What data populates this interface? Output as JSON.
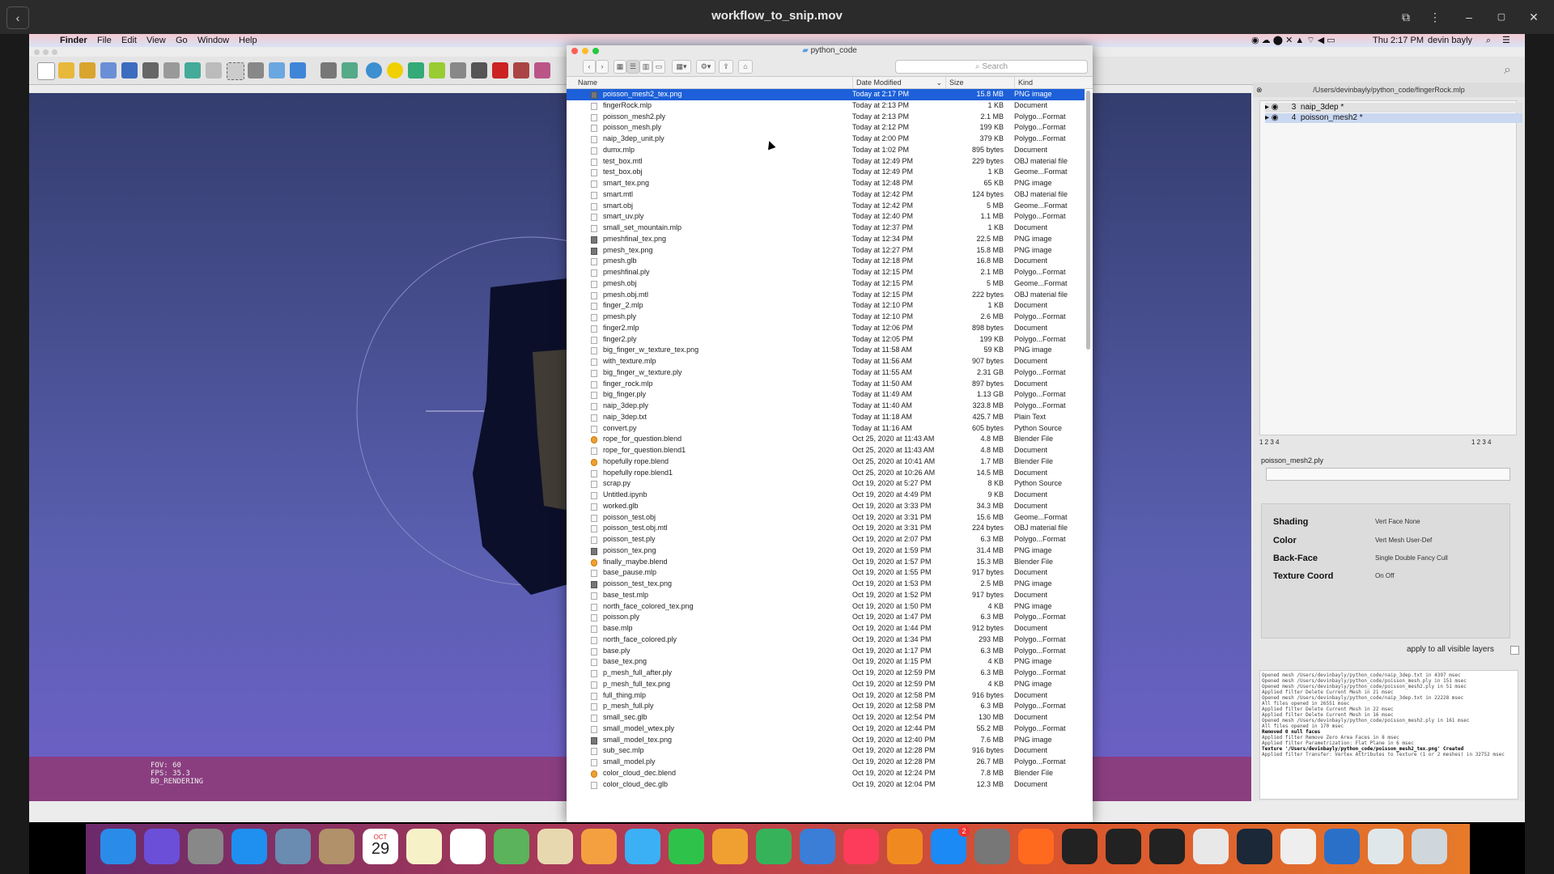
{
  "player": {
    "title": "workflow_to_snip.mov",
    "back_icon": "‹",
    "min_icon": "–",
    "max_icon": "▢",
    "close_icon": "✕"
  },
  "menubar": {
    "app_name": "Finder",
    "menus": [
      "File",
      "Edit",
      "View",
      "Go",
      "Window",
      "Help"
    ],
    "clock": "Thu 2:17 PM",
    "user": "devin bayly"
  },
  "meshlab": {
    "fov_lines": [
      "FOV: 60",
      "FPS:   35.3",
      "BO_RENDERING"
    ],
    "right_panel": {
      "path": "/Users/devinbayly/python_code/fingerRock.mlp",
      "layers": [
        {
          "index": "3",
          "name": "naip_3dep *"
        },
        {
          "index": "4",
          "name": "poisson_mesh2 *"
        }
      ],
      "pager_left": "1  2  3  4",
      "pager_right": "1  2  3  4",
      "mesh_name": "poisson_mesh2.ply",
      "settings": [
        {
          "label": "Shading",
          "options": "Vert  Face  None"
        },
        {
          "label": "Color",
          "options": "Vert  Mesh  User-Def"
        },
        {
          "label": "Back-Face",
          "options": "Single  Double  Fancy  Cull"
        },
        {
          "label": "Texture Coord",
          "options": "On  Off"
        }
      ],
      "apply_label": "apply to all visible layers",
      "log_lines": [
        "Opened mesh /Users/devinbayly/python_code/naip_3dep.txt in 4397 msec",
        "Opened mesh /Users/devinbayly/python_code/poisson_mesh.ply in 151 msec",
        "Opened mesh /Users/devinbayly/python_code/poisson_mesh2.ply in 51 msec",
        "Applied filter Delete Current Mesh in 21 msec",
        "Opened mesh /Users/devinbayly/python_code/naip_3dep.txt in 22228 msec",
        "All files opened in 26551 msec",
        "Applied filter Delete Current Mesh in 22 msec",
        "Applied filter Delete Current Mesh in 16 msec",
        "Opened mesh /Users/devinbayly/python_code/poisson_mesh2.ply in 161 msec",
        "All files opened in 170 msec",
        "Removed 0 null faces",
        "Applied filter Remove Zero Area Faces in 8 msec",
        "Applied filter Parametrization: Flat Plane in 6 msec",
        "Texture '/Users/devinbayly/python_code/poisson_mesh2_tex.png' Created",
        "Applied filter Transfer: Vertex Attributes to Texture (1 or 2 meshes) in 32752 msec"
      ]
    }
  },
  "finder": {
    "folder_title": "python_code",
    "search_placeholder": "Search",
    "columns": {
      "name": "Name",
      "date": "Date Modified",
      "size": "Size",
      "kind": "Kind"
    },
    "files": [
      {
        "name": "poisson_mesh2_tex.png",
        "date": "Today at 2:17 PM",
        "size": "15.8 MB",
        "kind": "PNG image",
        "icon": "img",
        "selected": true
      },
      {
        "name": "fingerRock.mlp",
        "date": "Today at 2:13 PM",
        "size": "1 KB",
        "kind": "Document",
        "icon": "doc"
      },
      {
        "name": "poisson_mesh2.ply",
        "date": "Today at 2:13 PM",
        "size": "2.1 MB",
        "kind": "Polygo...Format",
        "icon": "doc"
      },
      {
        "name": "poisson_mesh.ply",
        "date": "Today at 2:12 PM",
        "size": "199 KB",
        "kind": "Polygo...Format",
        "icon": "doc"
      },
      {
        "name": "naip_3dep_unit.ply",
        "date": "Today at 2:00 PM",
        "size": "379 KB",
        "kind": "Polygo...Format",
        "icon": "doc"
      },
      {
        "name": "dumx.mlp",
        "date": "Today at 1:02 PM",
        "size": "895 bytes",
        "kind": "Document",
        "icon": "doc"
      },
      {
        "name": "test_box.mtl",
        "date": "Today at 12:49 PM",
        "size": "229 bytes",
        "kind": "OBJ material file",
        "icon": "doc"
      },
      {
        "name": "test_box.obj",
        "date": "Today at 12:49 PM",
        "size": "1 KB",
        "kind": "Geome...Format",
        "icon": "doc"
      },
      {
        "name": "smart_tex.png",
        "date": "Today at 12:48 PM",
        "size": "65 KB",
        "kind": "PNG image",
        "icon": "doc"
      },
      {
        "name": "smart.mtl",
        "date": "Today at 12:42 PM",
        "size": "124 bytes",
        "kind": "OBJ material file",
        "icon": "doc"
      },
      {
        "name": "smart.obj",
        "date": "Today at 12:42 PM",
        "size": "5 MB",
        "kind": "Geome...Format",
        "icon": "doc"
      },
      {
        "name": "smart_uv.ply",
        "date": "Today at 12:40 PM",
        "size": "1.1 MB",
        "kind": "Polygo...Format",
        "icon": "doc"
      },
      {
        "name": "small_set_mountain.mlp",
        "date": "Today at 12:37 PM",
        "size": "1 KB",
        "kind": "Document",
        "icon": "doc"
      },
      {
        "name": "pmeshfinal_tex.png",
        "date": "Today at 12:34 PM",
        "size": "22.5 MB",
        "kind": "PNG image",
        "icon": "img"
      },
      {
        "name": "pmesh_tex.png",
        "date": "Today at 12:27 PM",
        "size": "15.8 MB",
        "kind": "PNG image",
        "icon": "img"
      },
      {
        "name": "pmesh.glb",
        "date": "Today at 12:18 PM",
        "size": "16.8 MB",
        "kind": "Document",
        "icon": "doc"
      },
      {
        "name": "pmeshfinal.ply",
        "date": "Today at 12:15 PM",
        "size": "2.1 MB",
        "kind": "Polygo...Format",
        "icon": "doc"
      },
      {
        "name": "pmesh.obj",
        "date": "Today at 12:15 PM",
        "size": "5 MB",
        "kind": "Geome...Format",
        "icon": "doc"
      },
      {
        "name": "pmesh.obj.mtl",
        "date": "Today at 12:15 PM",
        "size": "222 bytes",
        "kind": "OBJ material file",
        "icon": "doc"
      },
      {
        "name": "finger_2.mlp",
        "date": "Today at 12:10 PM",
        "size": "1 KB",
        "kind": "Document",
        "icon": "doc"
      },
      {
        "name": "pmesh.ply",
        "date": "Today at 12:10 PM",
        "size": "2.6 MB",
        "kind": "Polygo...Format",
        "icon": "doc"
      },
      {
        "name": "finger2.mlp",
        "date": "Today at 12:06 PM",
        "size": "898 bytes",
        "kind": "Document",
        "icon": "doc"
      },
      {
        "name": "finger2.ply",
        "date": "Today at 12:05 PM",
        "size": "199 KB",
        "kind": "Polygo...Format",
        "icon": "doc"
      },
      {
        "name": "big_finger_w_texture_tex.png",
        "date": "Today at 11:58 AM",
        "size": "59 KB",
        "kind": "PNG image",
        "icon": "doc"
      },
      {
        "name": "with_texture.mlp",
        "date": "Today at 11:56 AM",
        "size": "907 bytes",
        "kind": "Document",
        "icon": "doc"
      },
      {
        "name": "big_finger_w_texture.ply",
        "date": "Today at 11:55 AM",
        "size": "2.31 GB",
        "kind": "Polygo...Format",
        "icon": "doc"
      },
      {
        "name": "finger_rock.mlp",
        "date": "Today at 11:50 AM",
        "size": "897 bytes",
        "kind": "Document",
        "icon": "doc"
      },
      {
        "name": "big_finger.ply",
        "date": "Today at 11:49 AM",
        "size": "1.13 GB",
        "kind": "Polygo...Format",
        "icon": "doc"
      },
      {
        "name": "naip_3dep.ply",
        "date": "Today at 11:40 AM",
        "size": "323.8 MB",
        "kind": "Polygo...Format",
        "icon": "doc"
      },
      {
        "name": "naip_3dep.txt",
        "date": "Today at 11:18 AM",
        "size": "425.7 MB",
        "kind": "Plain Text",
        "icon": "doc"
      },
      {
        "name": "convert.py",
        "date": "Today at 11:16 AM",
        "size": "605 bytes",
        "kind": "Python Source",
        "icon": "doc"
      },
      {
        "name": "rope_for_question.blend",
        "date": "Oct 25, 2020 at 11:43 AM",
        "size": "4.8 MB",
        "kind": "Blender File",
        "icon": "blend"
      },
      {
        "name": "rope_for_question.blend1",
        "date": "Oct 25, 2020 at 11:43 AM",
        "size": "4.8 MB",
        "kind": "Document",
        "icon": "doc"
      },
      {
        "name": "hopefully rope.blend",
        "date": "Oct 25, 2020 at 10:41 AM",
        "size": "1.7 MB",
        "kind": "Blender File",
        "icon": "blend"
      },
      {
        "name": "hopefully rope.blend1",
        "date": "Oct 25, 2020 at 10:26 AM",
        "size": "14.5 MB",
        "kind": "Document",
        "icon": "doc"
      },
      {
        "name": "scrap.py",
        "date": "Oct 19, 2020 at 5:27 PM",
        "size": "8 KB",
        "kind": "Python Source",
        "icon": "doc"
      },
      {
        "name": "Untitled.ipynb",
        "date": "Oct 19, 2020 at 4:49 PM",
        "size": "9 KB",
        "kind": "Document",
        "icon": "doc"
      },
      {
        "name": "worked.glb",
        "date": "Oct 19, 2020 at 3:33 PM",
        "size": "34.3 MB",
        "kind": "Document",
        "icon": "doc"
      },
      {
        "name": "poisson_test.obj",
        "date": "Oct 19, 2020 at 3:31 PM",
        "size": "15.6 MB",
        "kind": "Geome...Format",
        "icon": "doc"
      },
      {
        "name": "poisson_test.obj.mtl",
        "date": "Oct 19, 2020 at 3:31 PM",
        "size": "224 bytes",
        "kind": "OBJ material file",
        "icon": "doc"
      },
      {
        "name": "poisson_test.ply",
        "date": "Oct 19, 2020 at 2:07 PM",
        "size": "6.3 MB",
        "kind": "Polygo...Format",
        "icon": "doc"
      },
      {
        "name": "poisson_tex.png",
        "date": "Oct 19, 2020 at 1:59 PM",
        "size": "31.4 MB",
        "kind": "PNG image",
        "icon": "img"
      },
      {
        "name": "finally_maybe.blend",
        "date": "Oct 19, 2020 at 1:57 PM",
        "size": "15.3 MB",
        "kind": "Blender File",
        "icon": "blend"
      },
      {
        "name": "base_pause.mlp",
        "date": "Oct 19, 2020 at 1:55 PM",
        "size": "917 bytes",
        "kind": "Document",
        "icon": "doc"
      },
      {
        "name": "poisson_test_tex.png",
        "date": "Oct 19, 2020 at 1:53 PM",
        "size": "2.5 MB",
        "kind": "PNG image",
        "icon": "img"
      },
      {
        "name": "base_test.mlp",
        "date": "Oct 19, 2020 at 1:52 PM",
        "size": "917 bytes",
        "kind": "Document",
        "icon": "doc"
      },
      {
        "name": "north_face_colored_tex.png",
        "date": "Oct 19, 2020 at 1:50 PM",
        "size": "4 KB",
        "kind": "PNG image",
        "icon": "doc"
      },
      {
        "name": "poisson.ply",
        "date": "Oct 19, 2020 at 1:47 PM",
        "size": "6.3 MB",
        "kind": "Polygo...Format",
        "icon": "doc"
      },
      {
        "name": "base.mlp",
        "date": "Oct 19, 2020 at 1:44 PM",
        "size": "912 bytes",
        "kind": "Document",
        "icon": "doc"
      },
      {
        "name": "north_face_colored.ply",
        "date": "Oct 19, 2020 at 1:34 PM",
        "size": "293 MB",
        "kind": "Polygo...Format",
        "icon": "doc"
      },
      {
        "name": "base.ply",
        "date": "Oct 19, 2020 at 1:17 PM",
        "size": "6.3 MB",
        "kind": "Polygo...Format",
        "icon": "doc"
      },
      {
        "name": "base_tex.png",
        "date": "Oct 19, 2020 at 1:15 PM",
        "size": "4 KB",
        "kind": "PNG image",
        "icon": "doc"
      },
      {
        "name": "p_mesh_full_after.ply",
        "date": "Oct 19, 2020 at 12:59 PM",
        "size": "6.3 MB",
        "kind": "Polygo...Format",
        "icon": "doc"
      },
      {
        "name": "p_mesh_full_tex.png",
        "date": "Oct 19, 2020 at 12:59 PM",
        "size": "4 KB",
        "kind": "PNG image",
        "icon": "doc"
      },
      {
        "name": "full_thing.mlp",
        "date": "Oct 19, 2020 at 12:58 PM",
        "size": "916 bytes",
        "kind": "Document",
        "icon": "doc"
      },
      {
        "name": "p_mesh_full.ply",
        "date": "Oct 19, 2020 at 12:58 PM",
        "size": "6.3 MB",
        "kind": "Polygo...Format",
        "icon": "doc"
      },
      {
        "name": "small_sec.glb",
        "date": "Oct 19, 2020 at 12:54 PM",
        "size": "130 MB",
        "kind": "Document",
        "icon": "doc"
      },
      {
        "name": "small_model_wtex.ply",
        "date": "Oct 19, 2020 at 12:44 PM",
        "size": "55.2 MB",
        "kind": "Polygo...Format",
        "icon": "doc"
      },
      {
        "name": "small_model_tex.png",
        "date": "Oct 19, 2020 at 12:40 PM",
        "size": "7.6 MB",
        "kind": "PNG image",
        "icon": "img"
      },
      {
        "name": "sub_sec.mlp",
        "date": "Oct 19, 2020 at 12:28 PM",
        "size": "916 bytes",
        "kind": "Document",
        "icon": "doc"
      },
      {
        "name": "small_model.ply",
        "date": "Oct 19, 2020 at 12:28 PM",
        "size": "26.7 MB",
        "kind": "Polygo...Format",
        "icon": "doc"
      },
      {
        "name": "color_cloud_dec.blend",
        "date": "Oct 19, 2020 at 12:24 PM",
        "size": "7.8 MB",
        "kind": "Blender File",
        "icon": "blend"
      },
      {
        "name": "color_cloud_dec.glb",
        "date": "Oct 19, 2020 at 12:04 PM",
        "size": "12.3 MB",
        "kind": "Document",
        "icon": "doc"
      }
    ]
  },
  "dock": {
    "calendar_month": "OCT",
    "calendar_day": "29",
    "appstore_badge": "2",
    "icons": [
      "finder-icon",
      "siri-icon",
      "launchpad-icon",
      "safari-icon",
      "preview-icon",
      "contacts-icon",
      "calendar-icon",
      "notes-icon",
      "reminders-icon",
      "maps-icon",
      "xquartz-icon",
      "photos-icon",
      "messages-icon",
      "facetime-icon",
      "pages-icon",
      "numbers-icon",
      "keynote-icon",
      "music-icon",
      "books-icon",
      "app-store-icon",
      "system-preferences-icon",
      "firefox-icon",
      "activity-monitor-icon",
      "obs-icon",
      "terminal-icon",
      "chrome-icon",
      "steam-icon",
      "textedit-icon",
      "quicktime-icon",
      "meshlab-icon",
      "trash-icon"
    ]
  }
}
